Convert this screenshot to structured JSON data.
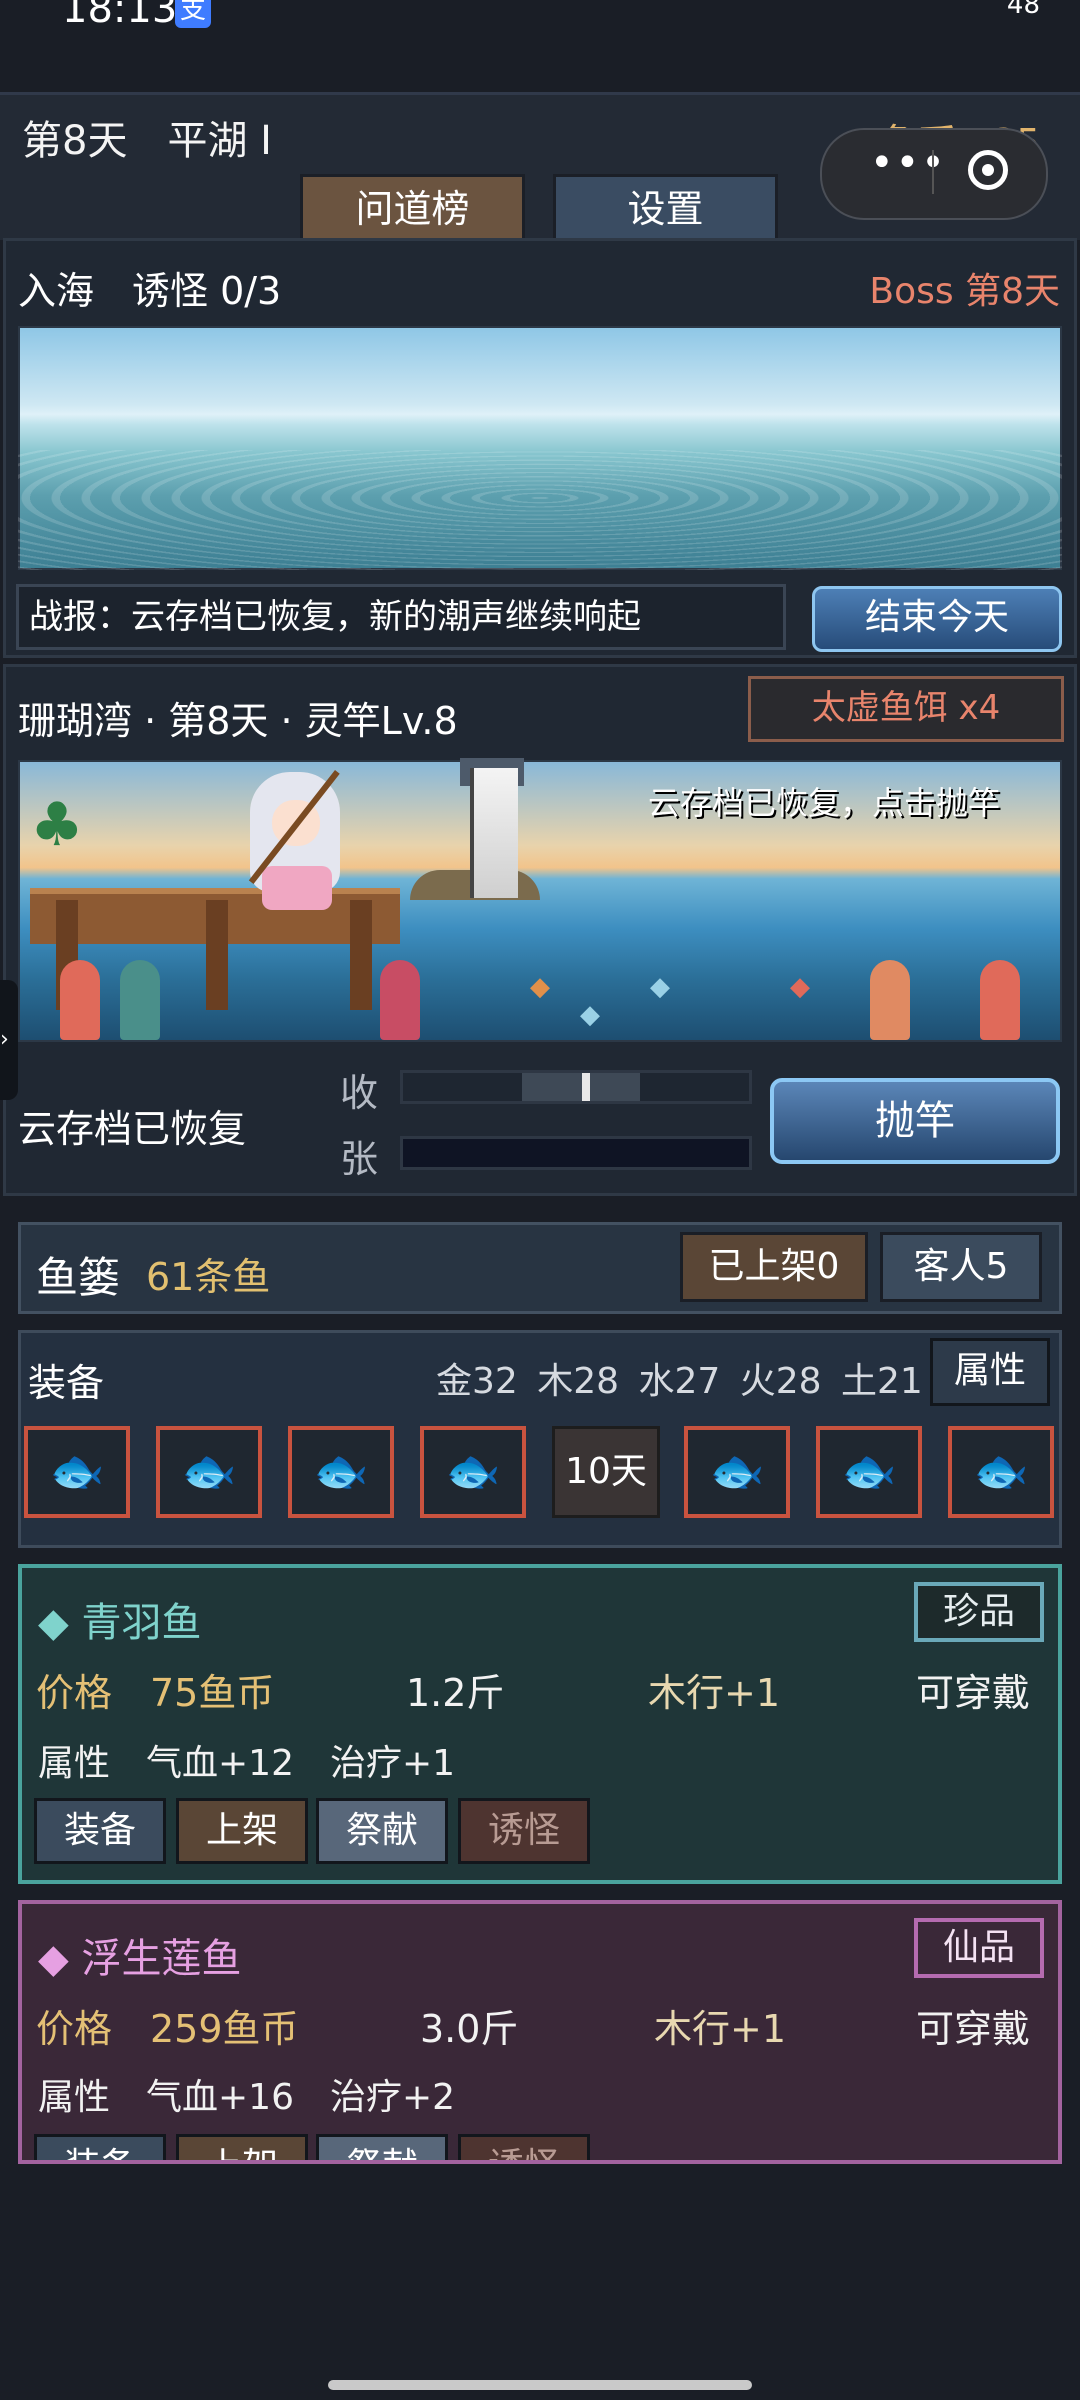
{
  "status_bar": {
    "time": "18:13",
    "app_badge": "支",
    "battery": "48"
  },
  "header": {
    "day": "第8天　平湖 I",
    "coins": "鱼币 535",
    "capsule_more": "•••",
    "tabs": [
      {
        "label": "问道榜"
      },
      {
        "label": "设置"
      }
    ]
  },
  "sea": {
    "title": "入海　诱怪 0/3",
    "boss": "Boss 第8天",
    "report": "战报：云存档已恢复，新的潮声继续响起",
    "end_day_button": "结束今天"
  },
  "fishing": {
    "location": "珊瑚湾 · 第8天 · 灵竿Lv.8",
    "bait": "太虚鱼饵 x4",
    "scene_hint": "云存档已恢复，点击抛竿",
    "status": "云存档已恢复",
    "reel_label": "收",
    "tension_label": "张",
    "reel_position": 0.53,
    "tension_level": 0.0,
    "cast_button": "抛竿"
  },
  "basket": {
    "title": "鱼篓",
    "count": "61条鱼",
    "listed_button": "已上架0",
    "guests_button": "客人5"
  },
  "equipment": {
    "title": "装备",
    "elements": "金32 木28 水27 火28 土21",
    "attr_button": "属性",
    "locked_slot": "10天",
    "slots": [
      {
        "icon": "golden-fish-icon",
        "color": "#e0b13a"
      },
      {
        "icon": "golden-fish-icon",
        "color": "#e0b13a"
      },
      {
        "icon": "golden-fish-icon",
        "color": "#e0b13a"
      },
      {
        "icon": "green-winged-fish-icon",
        "color": "#6fd28a"
      },
      {
        "icon": "blue-fish-icon",
        "color": "#5b8fe0"
      },
      {
        "icon": "golden-fish-icon",
        "color": "#e0b13a"
      },
      {
        "icon": "grey-fish-icon",
        "color": "#8a8275"
      }
    ]
  },
  "cards": [
    {
      "name": "青羽鱼",
      "rarity": "珍品",
      "price": "价格　75鱼币",
      "weight": "1.2斤",
      "element": "木行+1",
      "wearable": "可穿戴",
      "props": "属性　气血+12　治疗+1",
      "actions": [
        "装备",
        "上架",
        "祭献",
        "诱怪"
      ]
    },
    {
      "name": "浮生莲鱼",
      "rarity": "仙品",
      "price": "价格　259鱼币",
      "weight": "3.0斤",
      "element": "木行+1",
      "wearable": "可穿戴",
      "props": "属性　气血+16　治疗+2",
      "actions": [
        "装备",
        "上架",
        "祭献",
        "诱怪"
      ]
    }
  ]
}
